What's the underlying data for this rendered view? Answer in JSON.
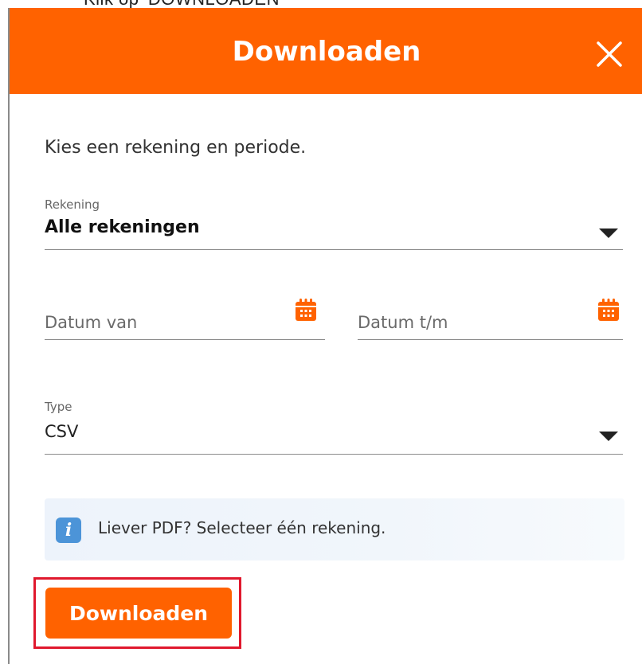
{
  "caption": {
    "text": "Klik op 'DOWNLOADEN'"
  },
  "dialog": {
    "title": "Downloaden",
    "close_icon": "close-icon",
    "intro": "Kies een rekening en periode.",
    "account": {
      "label": "Rekening",
      "value": "Alle rekeningen"
    },
    "date_from": {
      "placeholder": "Datum van",
      "icon": "calendar-icon"
    },
    "date_to": {
      "placeholder": "Datum t/m",
      "icon": "calendar-icon"
    },
    "type": {
      "label": "Type",
      "value": "CSV"
    },
    "info": {
      "icon": "info-icon",
      "text": "Liever PDF? Selecteer één rekening."
    },
    "download_button": "Downloaden"
  },
  "colors": {
    "brand": "#ff6200",
    "info_blue": "#4c94d8",
    "highlight": "#e0182d"
  }
}
